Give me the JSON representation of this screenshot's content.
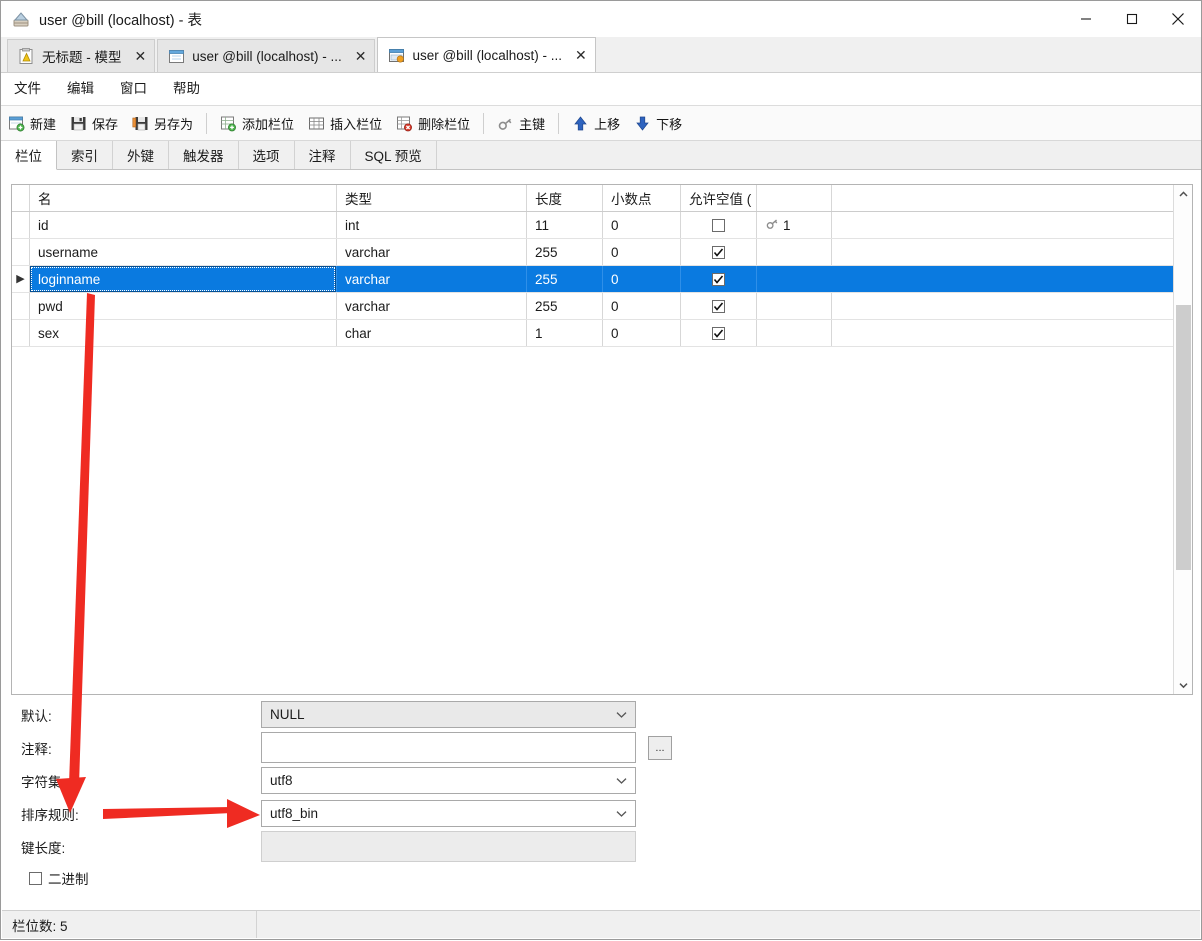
{
  "window": {
    "title": "user @bill (localhost) - 表",
    "icon": "table-window-icon",
    "minimize": "minimize-icon",
    "maximize": "maximize-icon",
    "close": "close-icon"
  },
  "tabs": [
    {
      "label": "无标题 - 模型",
      "icon": "model-icon",
      "close": "✕",
      "active": false
    },
    {
      "label": "user @bill (localhost) - ...",
      "icon": "query-icon",
      "close": "✕",
      "active": false
    },
    {
      "label": "user @bill (localhost) - ...",
      "icon": "table-icon",
      "close": "✕",
      "active": true
    }
  ],
  "menu": [
    "文件",
    "编辑",
    "窗口",
    "帮助"
  ],
  "toolbar": [
    {
      "label": "新建",
      "icon": "new-icon"
    },
    {
      "label": "保存",
      "icon": "save-icon"
    },
    {
      "label": "另存为",
      "icon": "save-as-icon"
    },
    {
      "sep": true
    },
    {
      "label": "添加栏位",
      "icon": "add-field-icon"
    },
    {
      "label": "插入栏位",
      "icon": "insert-field-icon"
    },
    {
      "label": "删除栏位",
      "icon": "delete-field-icon"
    },
    {
      "sep": true
    },
    {
      "label": "主键",
      "icon": "primary-key-icon"
    },
    {
      "sep": true
    },
    {
      "label": "上移",
      "icon": "move-up-icon"
    },
    {
      "label": "下移",
      "icon": "move-down-icon"
    }
  ],
  "section_tabs": [
    {
      "label": "栏位",
      "active": true
    },
    {
      "label": "索引",
      "active": false
    },
    {
      "label": "外键",
      "active": false
    },
    {
      "label": "触发器",
      "active": false
    },
    {
      "label": "选项",
      "active": false
    },
    {
      "label": "注释",
      "active": false
    },
    {
      "label": "SQL 预览",
      "active": false
    }
  ],
  "grid": {
    "columns": [
      "名",
      "类型",
      "长度",
      "小数点",
      "允许空值 ("
    ],
    "rows": [
      {
        "name": "id",
        "type": "int",
        "length": "11",
        "decimals": "0",
        "nullable": false,
        "key": "1",
        "selected": false,
        "indicator": ""
      },
      {
        "name": "username",
        "type": "varchar",
        "length": "255",
        "decimals": "0",
        "nullable": true,
        "key": "",
        "selected": false,
        "indicator": ""
      },
      {
        "name": "loginname",
        "type": "varchar",
        "length": "255",
        "decimals": "0",
        "nullable": true,
        "key": "",
        "selected": true,
        "indicator": "▶"
      },
      {
        "name": "pwd",
        "type": "varchar",
        "length": "255",
        "decimals": "0",
        "nullable": true,
        "key": "",
        "selected": false,
        "indicator": ""
      },
      {
        "name": "sex",
        "type": "char",
        "length": "1",
        "decimals": "0",
        "nullable": true,
        "key": "",
        "selected": false,
        "indicator": ""
      }
    ]
  },
  "properties": {
    "default_label": "默认:",
    "default_value": "NULL",
    "comment_label": "注释:",
    "comment_value": "",
    "comment_button": "...",
    "charset_label": "字符集:",
    "charset_value": "utf8",
    "collation_label": "排序规则:",
    "collation_value": "utf8_bin",
    "keylen_label": "键长度:",
    "keylen_value": "",
    "binary_label": "二进制",
    "binary_checked": false
  },
  "status": {
    "fields_count": "栏位数: 5",
    "right": ""
  },
  "colors": {
    "selection": "#0a7ae0",
    "annotation": "#ef2b22",
    "toolbar_bg": "#fafafa",
    "tab_bg": "#f0f0f0"
  },
  "annotations": [
    {
      "name": "arrow-to-collation-label",
      "from": "field-row-loginname",
      "to": "collation-label"
    },
    {
      "name": "arrow-to-collation-combo",
      "from": "collation-label",
      "to": "collation-combo"
    }
  ]
}
